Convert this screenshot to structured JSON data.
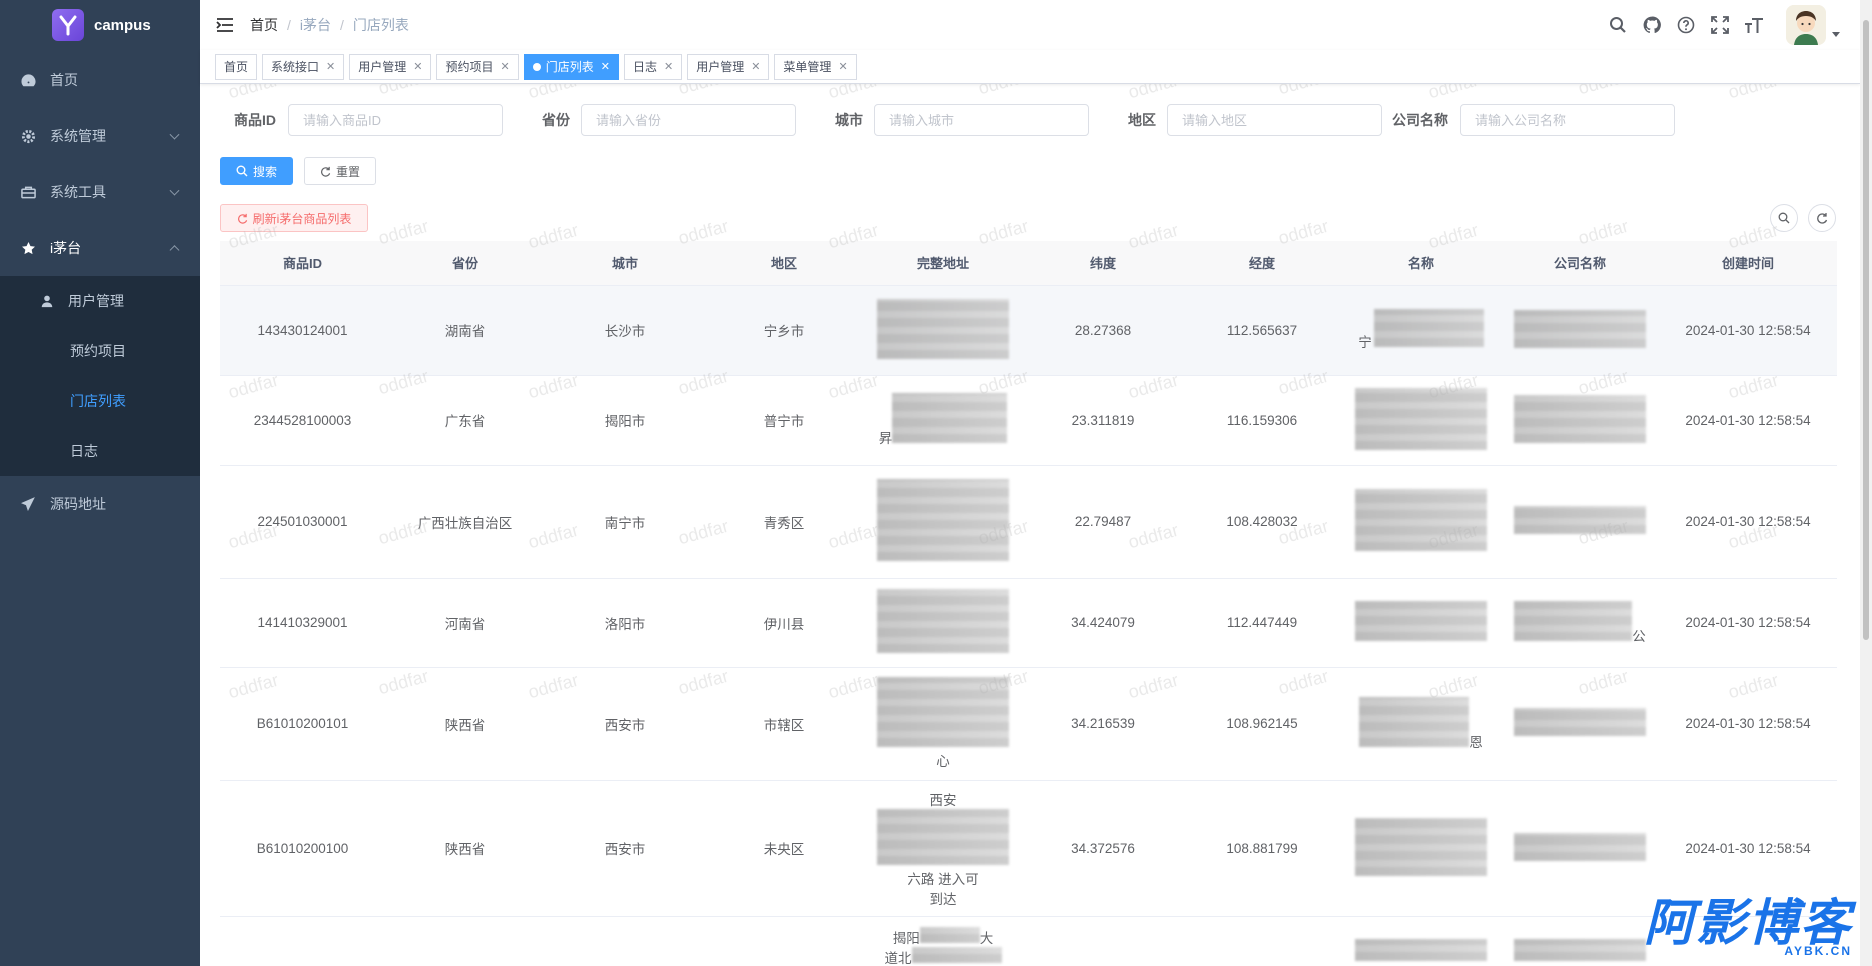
{
  "app": {
    "name": "campus"
  },
  "sidebar": {
    "items": [
      {
        "label": "首页",
        "icon": "dashboard-icon"
      },
      {
        "label": "系统管理",
        "icon": "gear-icon"
      },
      {
        "label": "系统工具",
        "icon": "toolbox-icon"
      },
      {
        "label": "i茅台",
        "icon": "star-icon"
      },
      {
        "label": "源码地址",
        "icon": "send-icon"
      }
    ],
    "submenu": {
      "group_label": "用户管理",
      "items": [
        "预约项目",
        "门店列表",
        "日志"
      ]
    }
  },
  "breadcrumb": [
    "首页",
    "i茅台",
    "门店列表"
  ],
  "tags": [
    {
      "label": "首页"
    },
    {
      "label": "系统接口"
    },
    {
      "label": "用户管理"
    },
    {
      "label": "预约项目"
    },
    {
      "label": "门店列表",
      "active": true
    },
    {
      "label": "日志"
    },
    {
      "label": "用户管理"
    },
    {
      "label": "菜单管理"
    }
  ],
  "search": {
    "fields": [
      {
        "label": "商品ID",
        "placeholder": "请输入商品ID"
      },
      {
        "label": "省份",
        "placeholder": "请输入省份"
      },
      {
        "label": "城市",
        "placeholder": "请输入城市"
      },
      {
        "label": "地区",
        "placeholder": "请输入地区"
      },
      {
        "label": "公司名称",
        "placeholder": "请输入公司名称"
      }
    ],
    "search_label": "搜索",
    "reset_label": "重置",
    "refresh_label": "刷新i茅台商品列表"
  },
  "table": {
    "headers": [
      "商品ID",
      "省份",
      "城市",
      "地区",
      "完整地址",
      "纬度",
      "经度",
      "名称",
      "公司名称",
      "创建时间"
    ],
    "rows": [
      {
        "id": "143430124001",
        "province": "湖南省",
        "city": "长沙市",
        "district": "宁乡市",
        "lat": "28.27368",
        "lng": "112.565637",
        "created": "2024-01-30 12:58:54"
      },
      {
        "id": "2344528100003",
        "province": "广东省",
        "city": "揭阳市",
        "district": "普宁市",
        "lat": "23.311819",
        "lng": "116.159306",
        "created": "2024-01-30 12:58:54"
      },
      {
        "id": "224501030001",
        "province": "广西壮族自治区",
        "city": "南宁市",
        "district": "青秀区",
        "lat": "22.79487",
        "lng": "108.428032",
        "created": "2024-01-30 12:58:54"
      },
      {
        "id": "141410329001",
        "province": "河南省",
        "city": "洛阳市",
        "district": "伊川县",
        "lat": "34.424079",
        "lng": "112.447449",
        "created": "2024-01-30 12:58:54"
      },
      {
        "id": "B61010200101",
        "province": "陕西省",
        "city": "西安市",
        "district": "市辖区",
        "lat": "34.216539",
        "lng": "108.962145",
        "created": "2024-01-30 12:58:54"
      },
      {
        "id": "B61010200100",
        "province": "陕西省",
        "city": "西安市",
        "district": "未央区",
        "lat": "34.372576",
        "lng": "108.881799",
        "created": "2024-01-30 12:58:54"
      },
      {
        "id": "",
        "province": "",
        "city": "",
        "district": "",
        "lat": "",
        "lng": "",
        "created": ""
      }
    ],
    "address_fragments": [
      "宁",
      "昇",
      "心",
      "西安",
      "达",
      "揭阳",
      "大",
      "道北",
      "公",
      "恩",
      "到达",
      "六路",
      "进入可"
    ]
  },
  "watermark": "oddfar",
  "brand": {
    "main": "阿影博客",
    "sub": "AYBK.CN"
  },
  "colors": {
    "sidebar": "#304156",
    "submenu": "#1f2d3d",
    "primary": "#409eff",
    "danger": "#f56c6c"
  }
}
